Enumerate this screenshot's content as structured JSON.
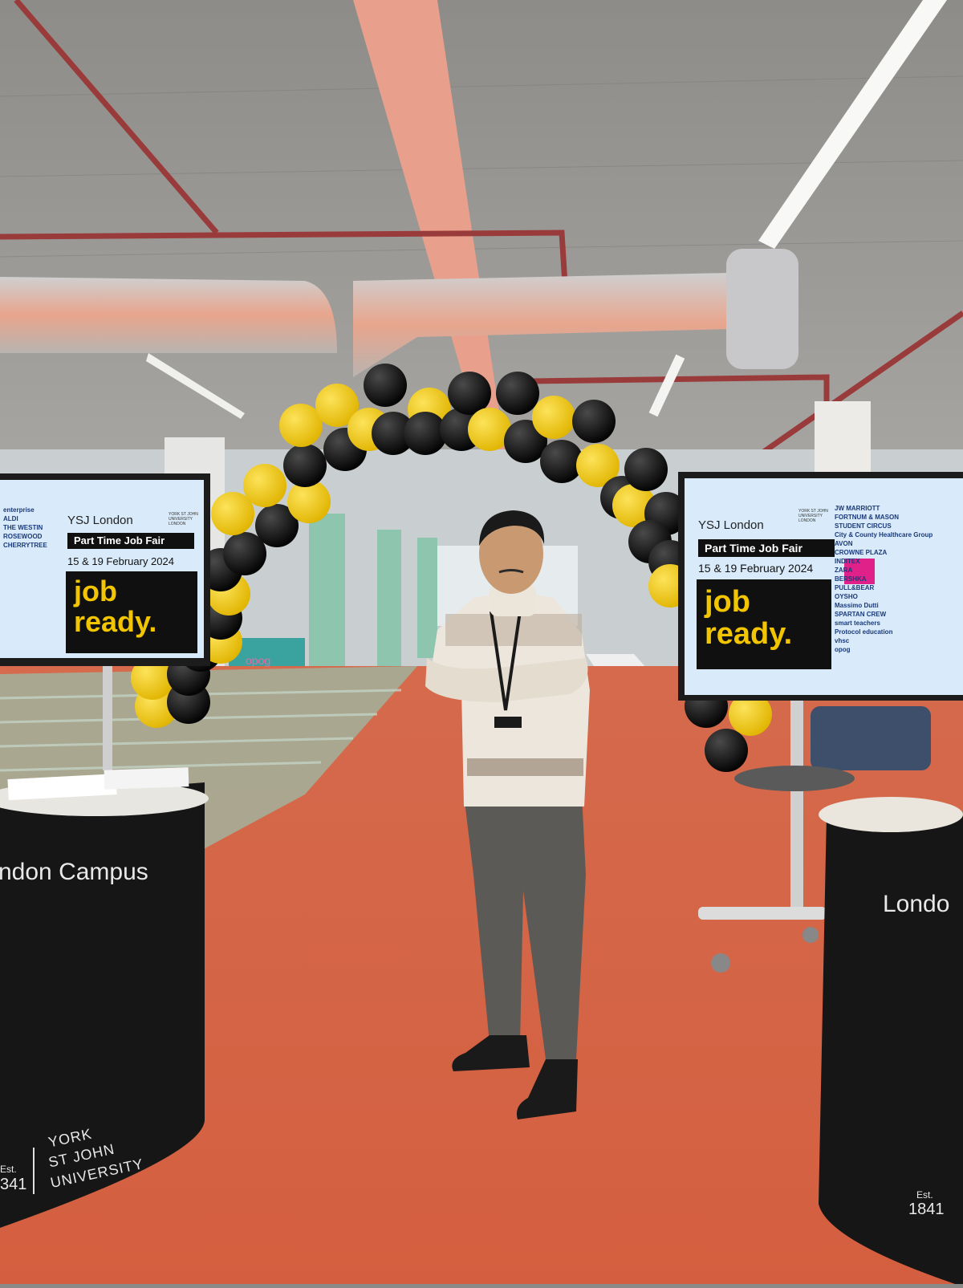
{
  "left_screen": {
    "org": "YSJ London",
    "crest": "YORK ST JOHN UNIVERSITY LONDON",
    "event": "Part Time Job Fair",
    "dates": "15 & 19 February 2024",
    "tagline_1": "job",
    "tagline_2": "ready.",
    "sponsors": [
      "enterprise",
      "ALDI",
      "THE WESTIN",
      "ROSEWOOD",
      "CHERRYTREE"
    ]
  },
  "right_screen": {
    "org": "YSJ London",
    "crest": "YORK ST JOHN UNIVERSITY LONDON",
    "event": "Part Time Job Fair",
    "dates": "15 & 19 February 2024",
    "tagline_1": "job",
    "tagline_2": "ready.",
    "sponsors": [
      "JW MARRIOTT",
      "FORTNUM & MASON",
      "STUDENT CIRCUS",
      "City & County Healthcare Group",
      "AVON",
      "CROWNE PLAZA",
      "INDITEX",
      "ZARA",
      "BERSHKA",
      "PULL&BEAR",
      "OYSHO",
      "Massimo Dutti",
      "SPARTAN CREW",
      "smart teachers",
      "Protocol education",
      "vhsc",
      "opog"
    ]
  },
  "left_counter": {
    "campus_label": "ndon Campus",
    "est_label": "Est.",
    "est_year": "341",
    "uni_line_1": "YORK",
    "uni_line_2": "ST JOHN",
    "uni_line_3": "UNIVERSITY"
  },
  "right_counter": {
    "campus_label": "Londo",
    "est_label": "Est.",
    "est_year": "1841"
  },
  "background_banner": "opog",
  "colors": {
    "floor": "#d8684a",
    "ceiling": "#9a9894",
    "balloon_yellow": "#f2c500",
    "balloon_black": "#111111",
    "screen_bg": "#d9ebfa",
    "counter": "#161616"
  }
}
